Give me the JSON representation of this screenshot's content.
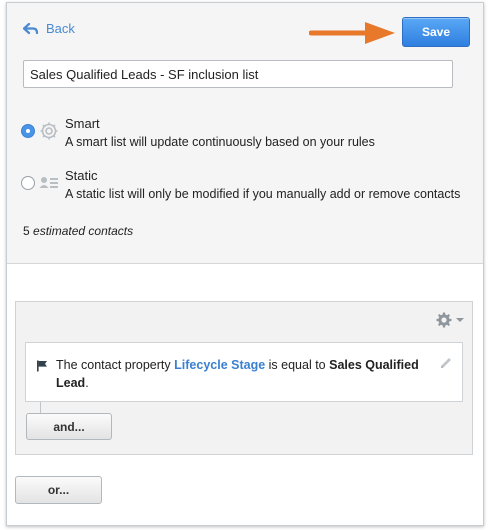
{
  "header": {
    "back_label": "Back",
    "save_label": "Save"
  },
  "list": {
    "name": "Sales Qualified Leads - SF inclusion list"
  },
  "list_type": {
    "selected": "Smart",
    "options": [
      {
        "title": "Smart",
        "description": "A smart list will update continuously based on your rules",
        "icon": "gear-icon"
      },
      {
        "title": "Static",
        "description": "A static list will only be modified if you manually add or remove contacts",
        "icon": "contact-card-icon"
      }
    ]
  },
  "estimate": {
    "count": "5",
    "label": "estimated contacts"
  },
  "filter": {
    "condition": {
      "prefix": "The contact property",
      "property": "Lifecycle Stage",
      "operator": "is equal to",
      "value": "Sales Qualified Lead",
      "suffix": "."
    },
    "and_label": "and...",
    "or_label": "or..."
  },
  "colors": {
    "accent": "#2f7fe0",
    "link": "#3b7fd0",
    "annotation_arrow": "#e8782a"
  }
}
